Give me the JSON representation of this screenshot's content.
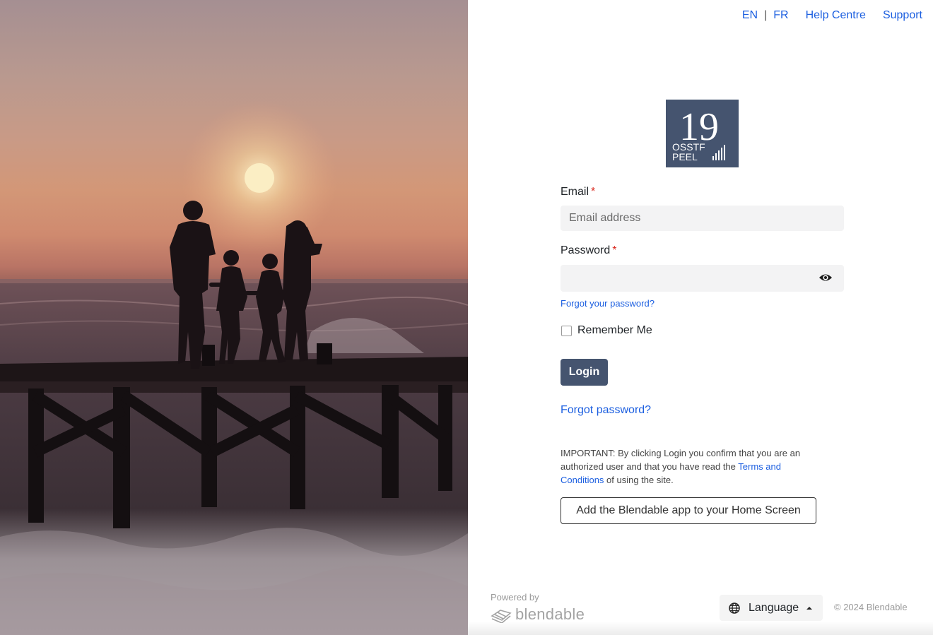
{
  "nav": {
    "en": "EN",
    "sep": "|",
    "fr": "FR",
    "help": "Help Centre",
    "support": "Support"
  },
  "logo": {
    "number": "19",
    "line1": "OSSTF",
    "line2": "PEEL"
  },
  "form": {
    "email_label": "Email",
    "email_placeholder": "Email address",
    "password_label": "Password",
    "required_mark": "*",
    "forgot_small": "Forgot your password?",
    "remember": "Remember Me",
    "login": "Login",
    "forgot": "Forgot password?",
    "notice_pre": "IMPORTANT: By clicking Login you confirm that you are an authorized user and that you have read the ",
    "notice_link": "Terms and Conditions",
    "notice_post": " of using the site.",
    "pwa": "Add the Blendable app to your Home Screen"
  },
  "footer": {
    "powered_by": "Powered by",
    "brand": "blendable",
    "language": "Language",
    "copyright": "© 2024 Blendable"
  },
  "colors": {
    "accent": "#45546f",
    "link": "#1c5fe0",
    "required": "#d9261c"
  },
  "icons": {
    "password_toggle": "eye-icon",
    "language": "globe-icon",
    "dropdown": "caret-up-icon",
    "brand": "blendable-logo-icon"
  }
}
